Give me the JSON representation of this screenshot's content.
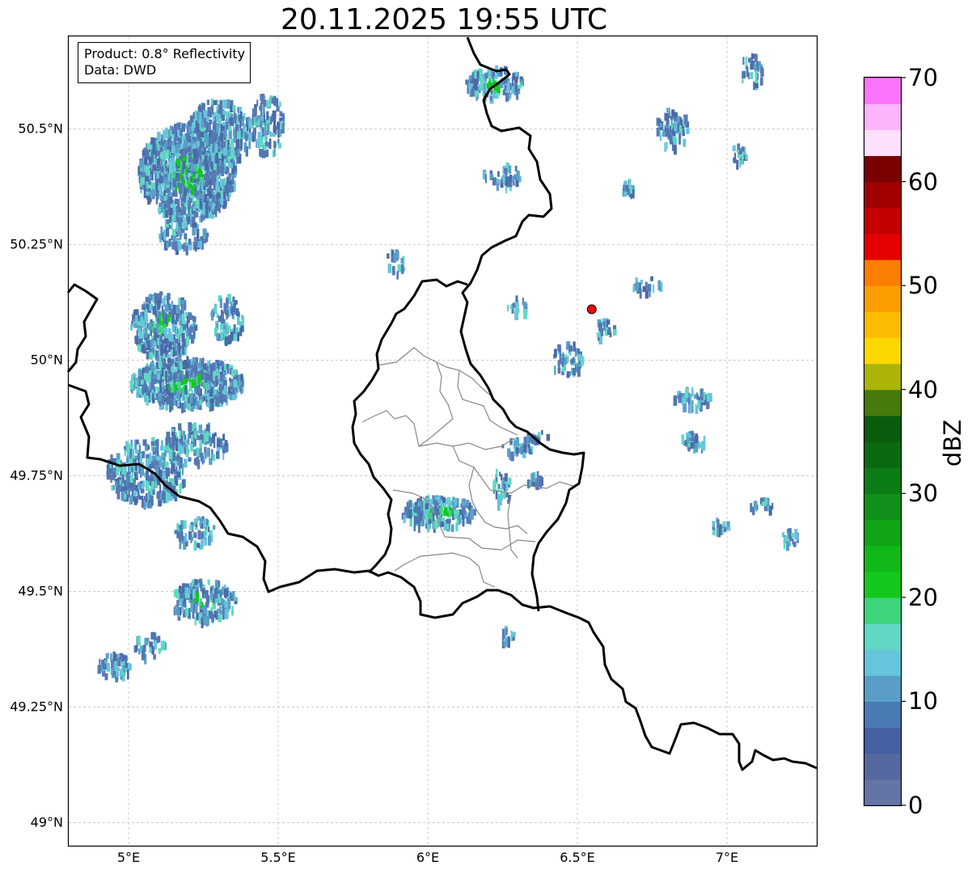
{
  "title": "20.11.2025 19:55 UTC",
  "info": {
    "product": "Product: 0.8° Reflectivity",
    "data": "Data: DWD"
  },
  "map": {
    "lon_range": [
      4.8,
      7.3
    ],
    "lat_range": [
      48.95,
      50.7
    ],
    "lat_ticks": [
      {
        "value": 50.5,
        "label": "50.5°N"
      },
      {
        "value": 50.25,
        "label": "50.25°N"
      },
      {
        "value": 50.0,
        "label": "50°N"
      },
      {
        "value": 49.75,
        "label": "49.75°N"
      },
      {
        "value": 49.5,
        "label": "49.5°N"
      },
      {
        "value": 49.25,
        "label": "49.25°N"
      },
      {
        "value": 49.0,
        "label": "49°N"
      }
    ],
    "lon_ticks": [
      {
        "value": 5.0,
        "label": "5°E"
      },
      {
        "value": 5.5,
        "label": "5.5°E"
      },
      {
        "value": 6.0,
        "label": "6°E"
      },
      {
        "value": 6.5,
        "label": "6.5°E"
      },
      {
        "value": 7.0,
        "label": "7°E"
      }
    ],
    "grid": true,
    "radar_site": {
      "lon": 6.548,
      "lat": 50.11,
      "color": "#ff0000"
    }
  },
  "colorbar": {
    "label": "dBZ",
    "vmin": 0,
    "vmax": 70,
    "step": 2.5,
    "ticks": [
      "0",
      "10",
      "20",
      "30",
      "40",
      "50",
      "60",
      "70"
    ],
    "colors": [
      "#6474a4",
      "#5668a0",
      "#4660a4",
      "#4a7ab4",
      "#5a9ec8",
      "#66c4dc",
      "#60d8c4",
      "#3ed47a",
      "#12c81a",
      "#10b818",
      "#10a416",
      "#10901a",
      "#0c7c16",
      "#0a6a12",
      "#0a5c0c",
      "#467a0c",
      "#acb408",
      "#fcd800",
      "#fcbc00",
      "#fc9e00",
      "#fc7e00",
      "#e40000",
      "#c40000",
      "#a00000",
      "#7a0000",
      "#fce0fc",
      "#fcb4fc",
      "#fc74fc",
      "#ec3cec"
    ]
  }
}
